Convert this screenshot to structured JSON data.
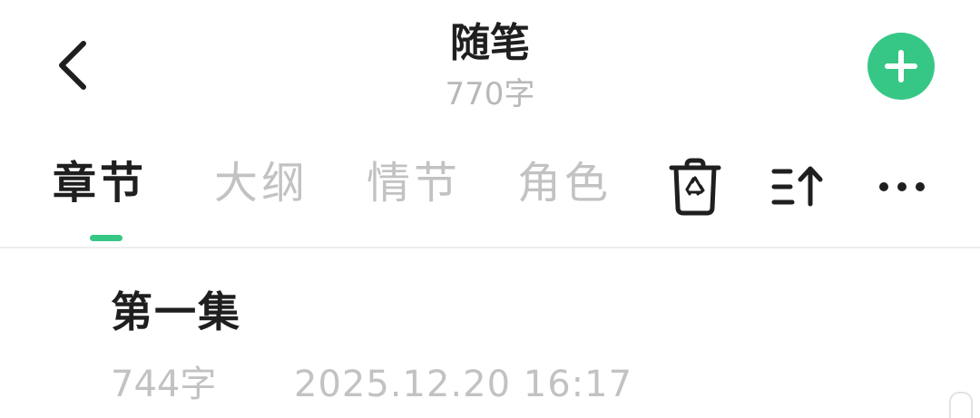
{
  "header": {
    "title": "随笔",
    "word_count": "770字",
    "back_icon": "chevron-left-icon",
    "add_icon": "plus-icon",
    "accent_color": "#36c786"
  },
  "tabs": [
    {
      "label": "章节",
      "active": true
    },
    {
      "label": "大纲",
      "active": false
    },
    {
      "label": "情节",
      "active": false
    },
    {
      "label": "角色",
      "active": false
    }
  ],
  "toolbar": {
    "icons": [
      "recycle-bin-icon",
      "sort-ascending-icon",
      "more-icon"
    ]
  },
  "chapters": [
    {
      "title": "第一集",
      "word_count": "744字",
      "updated": "2025.12.20 16:17"
    }
  ]
}
